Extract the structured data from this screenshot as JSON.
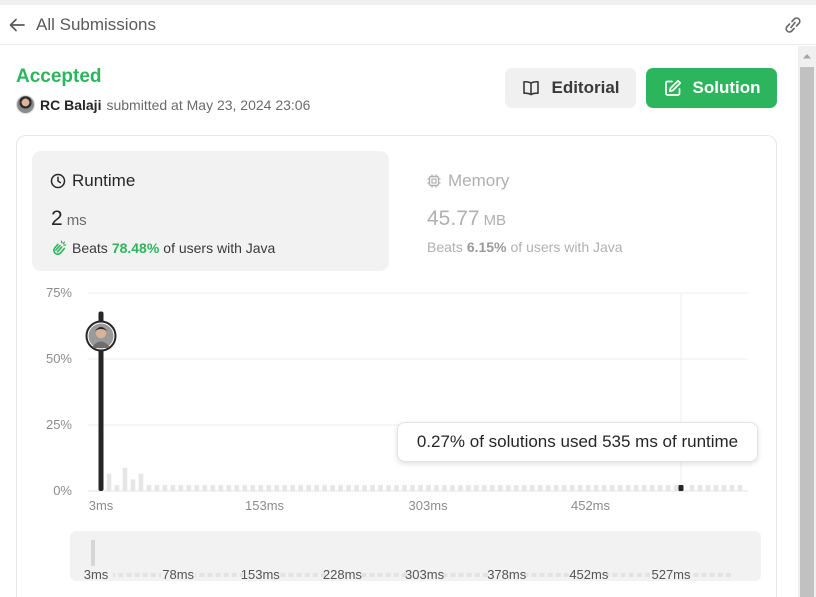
{
  "header": {
    "back_label": "All Submissions"
  },
  "submission": {
    "status": "Accepted",
    "author": "RC Balaji",
    "submitted_text": "submitted at May 23, 2024 23:06"
  },
  "buttons": {
    "editorial": "Editorial",
    "solution": "Solution"
  },
  "runtime": {
    "title": "Runtime",
    "value": "2",
    "unit": "ms",
    "beats_prefix": "Beats",
    "beats_pct": "78.48%",
    "beats_suffix": "of users with Java"
  },
  "memory": {
    "title": "Memory",
    "value": "45.77",
    "unit": "MB",
    "beats_prefix": "Beats",
    "beats_pct": "6.15%",
    "beats_suffix": "of users with Java"
  },
  "tooltip": "0.27% of solutions used 535 ms of runtime",
  "colors": {
    "accent": "#2db55d",
    "bar_main": "#262626",
    "bar_other": "#e6e6e6"
  },
  "chart_data": {
    "type": "bar",
    "ylim": [
      0,
      75
    ],
    "y_ticks": [
      "75%",
      "50%",
      "25%",
      "0%"
    ],
    "x_ticks": [
      {
        "label": "3ms",
        "ms": 3
      },
      {
        "label": "153ms",
        "ms": 153
      },
      {
        "label": "303ms",
        "ms": 303
      },
      {
        "label": "452ms",
        "ms": 452
      }
    ],
    "x_range_ms": [
      3,
      535
    ],
    "highlighted": {
      "ms": 2,
      "percent": 68
    },
    "hovered": {
      "ms": 535,
      "percent": 0.27
    },
    "others_percent": [
      3,
      1,
      4,
      2,
      3,
      1,
      1,
      1,
      1,
      1,
      1,
      1,
      1,
      1,
      1,
      1,
      1,
      1,
      1,
      1,
      1,
      1,
      1,
      1,
      1,
      1,
      1,
      1,
      1,
      1,
      1,
      1,
      1,
      1,
      1,
      1,
      1,
      1,
      1,
      1,
      1,
      1,
      1,
      1,
      1,
      1,
      1,
      1,
      1,
      1,
      1,
      1,
      1,
      1,
      1,
      1,
      1,
      1,
      1,
      1,
      1,
      1,
      1,
      1,
      1,
      1,
      1,
      1,
      1,
      1,
      1,
      1,
      1,
      1,
      1,
      1,
      1,
      1,
      1,
      1
    ]
  },
  "range_selector": {
    "ticks": [
      "3ms",
      "78ms",
      "153ms",
      "228ms",
      "303ms",
      "378ms",
      "452ms",
      "527ms"
    ]
  }
}
